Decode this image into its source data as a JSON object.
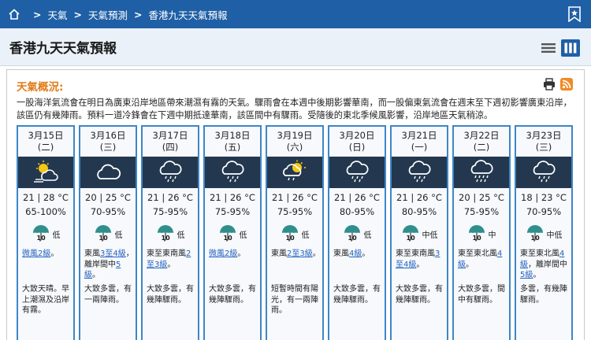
{
  "breadcrumb": {
    "items": [
      "天氣",
      "天氣預測",
      "香港九天天氣預報"
    ],
    "separator": ">"
  },
  "page": {
    "title": "香港九天天氣預報"
  },
  "general": {
    "title": "天氣概況:",
    "text": "一股海洋氣流會在明日為廣東沿岸地區帶來潮濕有霧的天氣。驟雨會在本週中後期影響華南，而一股偏東氣流會在週末至下週初影響廣東沿岸，該區仍有幾陣雨。預料一道冷鋒會在下週中期抵達華南，該區間中有驟雨。受隨後的東北季候風影響，沿岸地區天氣稍涼。"
  },
  "colors": {
    "topbar": "#1f5fa6",
    "accent": "#e07b17",
    "link": "#2463c1",
    "iconbg": "#23384f",
    "border": "#3e86c6"
  },
  "days": [
    {
      "date": "3月15日",
      "weekday": "(二)",
      "icon": "sun-cloud-fog-icon",
      "temp": "21 | 28 °C",
      "rh": "65-100%",
      "psr_num": "10",
      "psr": "低",
      "wind_parts": [
        {
          "t": "微風2級",
          "link": true
        },
        {
          "t": "。",
          "link": false
        }
      ],
      "desc": "大致天晴。早上潮濕及沿岸有霧。"
    },
    {
      "date": "3月16日",
      "weekday": "(三)",
      "icon": "cloud-icon",
      "temp": "20 | 25 °C",
      "rh": "70-95%",
      "psr_num": "10",
      "psr": "低",
      "wind_parts": [
        {
          "t": "東風",
          "link": false
        },
        {
          "t": "3至4級",
          "link": true
        },
        {
          "t": "，離岸間中",
          "link": false
        },
        {
          "t": "5級",
          "link": true
        },
        {
          "t": "。",
          "link": false
        }
      ],
      "desc": "大致多雲，有一兩陣雨。"
    },
    {
      "date": "3月17日",
      "weekday": "(四)",
      "icon": "cloud-rain-icon",
      "temp": "21 | 26 °C",
      "rh": "75-95%",
      "psr_num": "10",
      "psr": "低",
      "wind_parts": [
        {
          "t": "東至東南風",
          "link": false
        },
        {
          "t": "2至3級",
          "link": true
        },
        {
          "t": "。",
          "link": false
        }
      ],
      "desc": "大致多雲，有幾陣驟雨。"
    },
    {
      "date": "3月18日",
      "weekday": "(五)",
      "icon": "cloud-rain-icon",
      "temp": "21 | 26 °C",
      "rh": "75-95%",
      "psr_num": "10",
      "psr": "低",
      "wind_parts": [
        {
          "t": "微風2級",
          "link": true
        },
        {
          "t": "。",
          "link": false
        }
      ],
      "desc": "大致多雲，有幾陣驟雨。"
    },
    {
      "date": "3月19日",
      "weekday": "(六)",
      "icon": "sun-cloud-rain-icon",
      "temp": "21 | 26 °C",
      "rh": "75-95%",
      "psr_num": "10",
      "psr": "低",
      "wind_parts": [
        {
          "t": "東風",
          "link": false
        },
        {
          "t": "2至3級",
          "link": true
        },
        {
          "t": "。",
          "link": false
        }
      ],
      "desc": "短暫時間有陽光，有一兩陣雨。"
    },
    {
      "date": "3月20日",
      "weekday": "(日)",
      "icon": "cloud-rain-icon",
      "temp": "21 | 26 °C",
      "rh": "80-95%",
      "psr_num": "10",
      "psr": "低",
      "wind_parts": [
        {
          "t": "東風",
          "link": false
        },
        {
          "t": "4級",
          "link": true
        },
        {
          "t": "。",
          "link": false
        }
      ],
      "desc": "大致多雲，有幾陣驟雨。"
    },
    {
      "date": "3月21日",
      "weekday": "(一)",
      "icon": "cloud-rain-icon",
      "temp": "21 | 26 °C",
      "rh": "80-95%",
      "psr_num": "10",
      "psr": "中低",
      "wind_parts": [
        {
          "t": "東至東南風",
          "link": false
        },
        {
          "t": "3至4級",
          "link": true
        },
        {
          "t": "。",
          "link": false
        }
      ],
      "desc": "大致多雲，有幾陣驟雨。"
    },
    {
      "date": "3月22日",
      "weekday": "(二)",
      "icon": "cloud-heavy-rain-icon",
      "temp": "20 | 25 °C",
      "rh": "75-95%",
      "psr_num": "10",
      "psr": "中",
      "wind_parts": [
        {
          "t": "東至東北風",
          "link": false
        },
        {
          "t": "4級",
          "link": true
        },
        {
          "t": "。",
          "link": false
        }
      ],
      "desc": "大致多雲，間中有驟雨。"
    },
    {
      "date": "3月23日",
      "weekday": "(三)",
      "icon": "cloud-rain-icon",
      "temp": "18 | 23 °C",
      "rh": "70-95%",
      "psr_num": "10",
      "psr": "中低",
      "wind_parts": [
        {
          "t": "東至東北風",
          "link": false
        },
        {
          "t": "4級",
          "link": true
        },
        {
          "t": "，離岸間中",
          "link": false
        },
        {
          "t": "5級",
          "link": true
        },
        {
          "t": "。",
          "link": false
        }
      ],
      "desc": "多雲，有幾陣驟雨。"
    }
  ]
}
